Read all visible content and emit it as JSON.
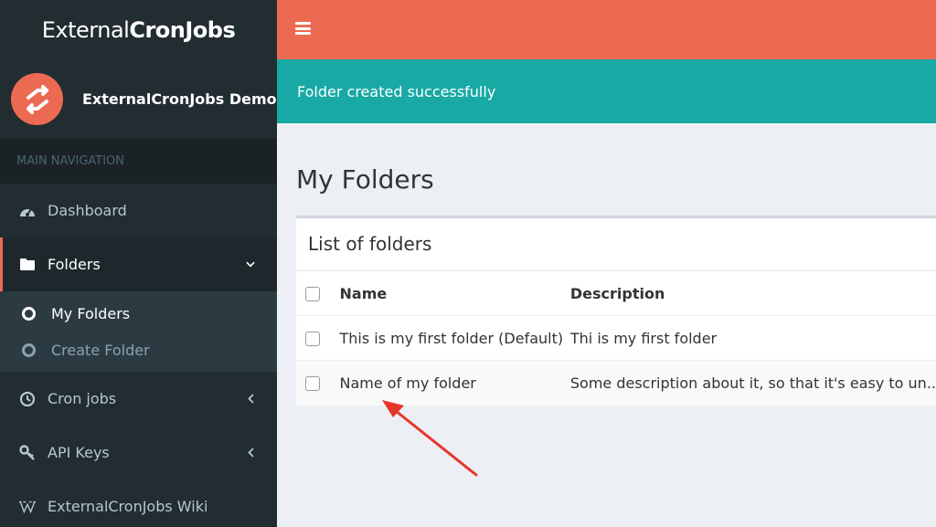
{
  "app": {
    "logo_light": "External",
    "logo_bold": "CronJobs",
    "user_name": "ExternalCronJobs Demo"
  },
  "sidebar": {
    "header": "MAIN NAVIGATION",
    "items": [
      {
        "label": "Dashboard",
        "icon": "dashboard-icon"
      },
      {
        "label": "Folders",
        "icon": "folder-icon",
        "active": true,
        "expanded": true
      },
      {
        "label": "Cron jobs",
        "icon": "clock-icon"
      },
      {
        "label": "API Keys",
        "icon": "key-icon"
      },
      {
        "label": "ExternalCronJobs Wiki",
        "icon": "wikipedia-icon"
      }
    ],
    "subitems": [
      {
        "label": "My Folders",
        "active": true
      },
      {
        "label": "Create Folder"
      }
    ]
  },
  "alert": {
    "message": "Folder created successfully"
  },
  "page": {
    "title": "My Folders"
  },
  "box": {
    "title": "List of folders",
    "columns": [
      "Name",
      "Description"
    ],
    "rows": [
      {
        "name": "This is my first folder (Default)",
        "description": "Thi is my first folder"
      },
      {
        "name": "Name of my folder",
        "description": "Some description about it, so that it's easy to un.."
      }
    ]
  },
  "colors": {
    "accent": "#ec6a52",
    "sidebar_bg": "#222d32",
    "alert_bg": "#18a9a5",
    "annotation_arrow": "#e8352b"
  }
}
